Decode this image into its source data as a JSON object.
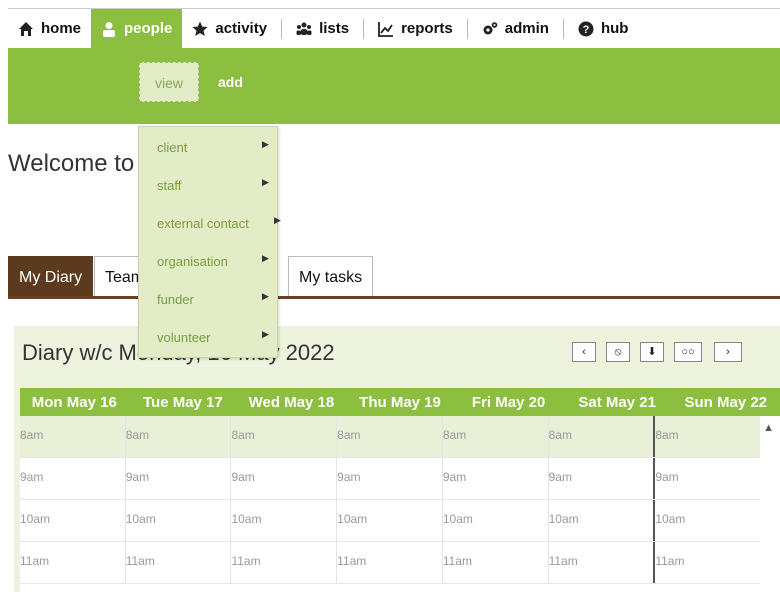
{
  "topnav": {
    "items": [
      {
        "label": "home",
        "icon": "home-icon"
      },
      {
        "label": "people",
        "icon": "person-icon"
      },
      {
        "label": "activity",
        "icon": "star-icon"
      },
      {
        "label": "lists",
        "icon": "users-icon"
      },
      {
        "label": "reports",
        "icon": "chart-icon"
      },
      {
        "label": "admin",
        "icon": "gears-icon"
      },
      {
        "label": "hub",
        "icon": "question-icon"
      }
    ]
  },
  "subnav": {
    "view": "view",
    "add": "add"
  },
  "dropdown": {
    "items": [
      "client",
      "staff",
      "external contact",
      "organisation",
      "funder",
      "volunteer"
    ]
  },
  "welcome": "Welcome to L",
  "tabs": [
    "My Diary",
    "Team",
    "My tasks"
  ],
  "diary": {
    "title": "Diary w/c Monday, 16 May 2022",
    "controls": [
      "‹",
      "⦸",
      "⬇",
      "○○",
      "›"
    ],
    "days": [
      "Mon May 16",
      "Tue May 17",
      "Wed May 18",
      "Thu May 19",
      "Fri May 20",
      "Sat May 21",
      "Sun May 22"
    ],
    "times": [
      "8am",
      "9am",
      "10am",
      "11am"
    ]
  },
  "colors": {
    "accent": "#8cbf3f",
    "tab_active": "#5b3a1e",
    "dropdown_bg": "#e2ecc6",
    "dropdown_text": "#7a9d3f"
  }
}
